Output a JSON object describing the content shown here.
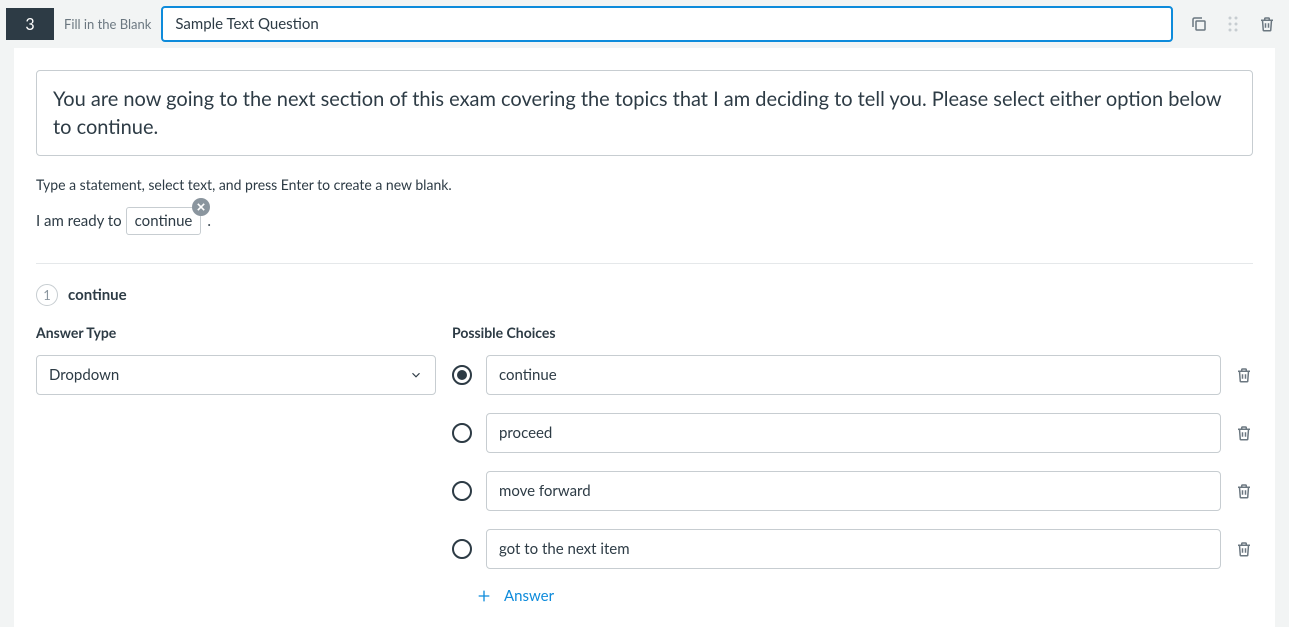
{
  "header": {
    "number": "3",
    "type_label": "Fill in the Blank",
    "title": "Sample Text Question"
  },
  "stem": "You are now going to the next section of this exam covering the topics that I am deciding to tell you. Please select either option below to continue.",
  "hint": "Type a statement, select text, and press Enter to create a new blank.",
  "statement": {
    "prefix": "I am ready to ",
    "blank_text": "continue",
    "suffix": "."
  },
  "blank": {
    "index": "1",
    "name": "continue"
  },
  "answer_type": {
    "label": "Answer Type",
    "value": "Dropdown"
  },
  "choices_label": "Possible Choices",
  "choices": [
    {
      "value": "continue",
      "selected": true
    },
    {
      "value": "proceed",
      "selected": false
    },
    {
      "value": "move forward",
      "selected": false
    },
    {
      "value": "got to the next item",
      "selected": false
    }
  ],
  "add_answer_label": "Answer"
}
